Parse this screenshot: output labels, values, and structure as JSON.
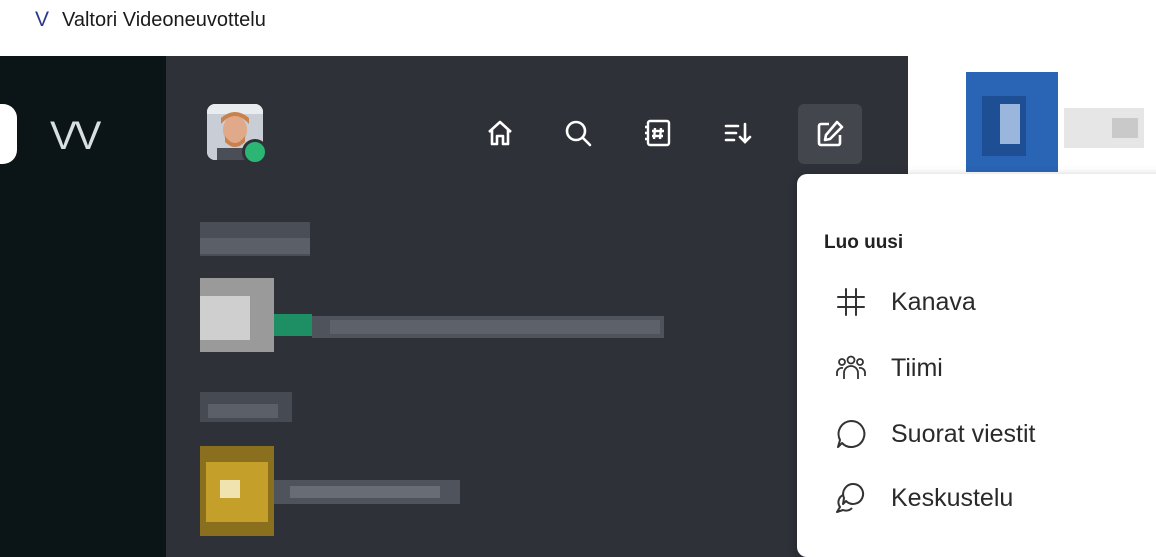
{
  "app": {
    "logo_letter": "V",
    "title": "Valtori Videoneuvottelu"
  },
  "rail": {
    "workspace_initials": "VV"
  },
  "sidebar": {
    "header_icons": [
      "home-icon",
      "search-icon",
      "directory-icon",
      "sort-icon",
      "compose-icon"
    ],
    "presence_color": "#2bb673"
  },
  "create_menu": {
    "heading": "Luo uusi",
    "items": [
      {
        "icon": "hashtag-icon",
        "label": "Kanava"
      },
      {
        "icon": "team-icon",
        "label": "Tiimi"
      },
      {
        "icon": "message-bubble-icon",
        "label": "Suorat viestit"
      },
      {
        "icon": "discussion-icon",
        "label": "Keskustelu"
      }
    ]
  },
  "colors": {
    "rail_bg": "#0b1417",
    "sidebar_bg": "#2e3138",
    "accent_green": "#2bb673",
    "brand_blue": "#1f5aa6"
  }
}
